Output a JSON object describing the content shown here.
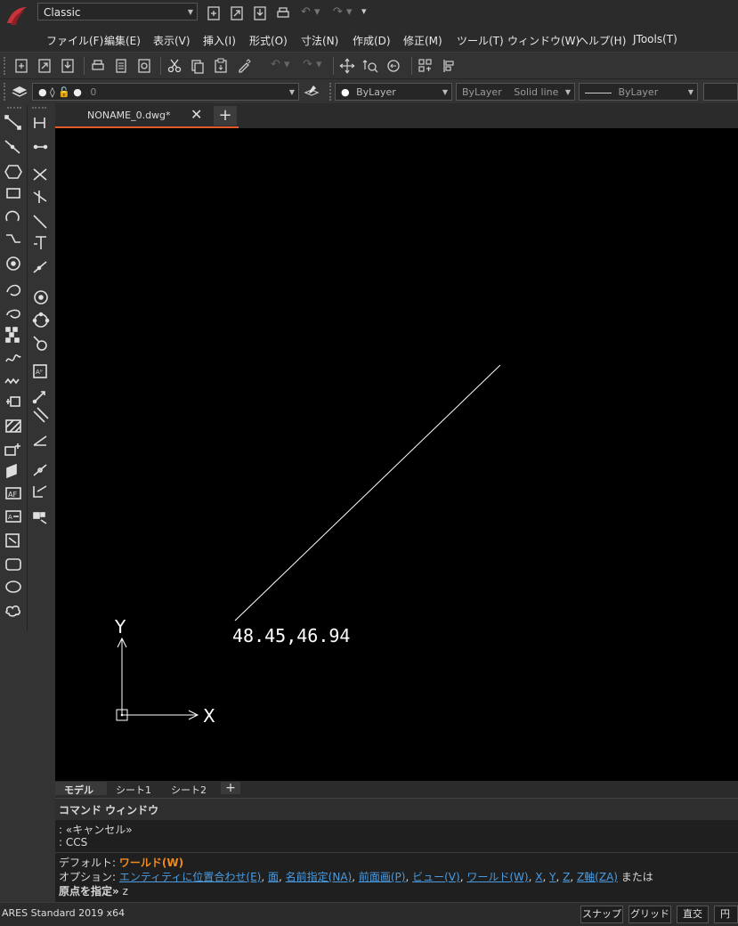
{
  "workspace": {
    "selected": "Classic"
  },
  "menu": [
    "ファイル(F)",
    "編集(E)",
    "表示(V)",
    "挿入(I)",
    "形式(O)",
    "寸法(N)",
    "作成(D)",
    "修正(M)",
    "ツール(T)",
    "ウィンドウ(W)",
    "ヘルプ(H)",
    "JTools(T)"
  ],
  "layer": {
    "current": "0",
    "color": "ByLayer",
    "linetype": "ByLayer",
    "linetype_name": "Solid line",
    "lineweight": "ByLayer"
  },
  "document_tab": {
    "label": "NONAME_0.dwg*"
  },
  "drawing": {
    "coordinate_text": "48.45,46.94",
    "axis_x": "X",
    "axis_y": "Y"
  },
  "sheet_tabs": [
    "モデル",
    "シート1",
    "シート2"
  ],
  "command_window": {
    "title": "コマンド ウィンドウ",
    "history": [
      ": «キャンセル»",
      ": CCS"
    ],
    "default_label": "デフォルト: ",
    "default_value": "ワールド(W)",
    "options_label": "オプション: ",
    "options": [
      "エンティティに位置合わせ(E)",
      "面",
      "名前指定(NA)",
      "前面画(P)",
      "ビュー(V)",
      "ワールド(W)",
      "X",
      "Y",
      "Z",
      "Z軸(ZA)"
    ],
    "options_suffix": " または",
    "prompt": "原点を指定»",
    "input": " z"
  },
  "status": {
    "app_name": "ARES Standard 2019 x64",
    "buttons": [
      "スナップ",
      "グリッド",
      "直交",
      "円形"
    ]
  },
  "colors": {
    "accent": "#e35a2a",
    "option_link": "#4a9be0",
    "default_value": "#f08a1c"
  }
}
